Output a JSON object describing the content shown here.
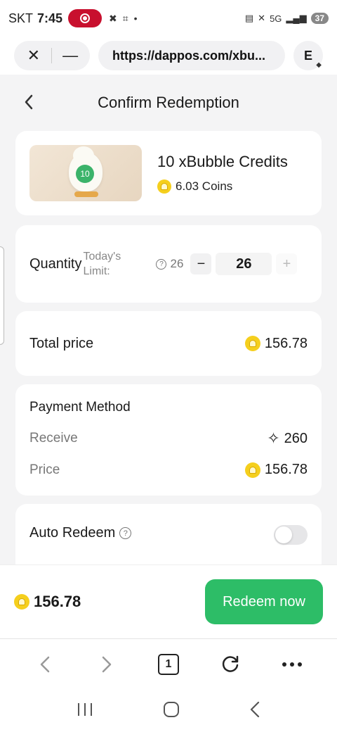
{
  "status_bar": {
    "carrier": "SKT",
    "time": "7:45",
    "network": "5G",
    "battery": "37"
  },
  "browser": {
    "url": "https://dappos.com/xbu...",
    "profile_initial": "E"
  },
  "page": {
    "title": "Confirm Redemption",
    "product": {
      "name": "10 xBubble Credits",
      "badge": "10",
      "price": "6.03 Coins"
    },
    "quantity": {
      "label": "Quantity",
      "limit_label": "Today's Limit:",
      "limit_value": "26",
      "value": "26",
      "minus": "−",
      "plus": "+"
    },
    "total": {
      "label": "Total price",
      "value": "156.78"
    },
    "payment": {
      "title": "Payment Method",
      "receive_label": "Receive",
      "receive_value": "260",
      "price_label": "Price",
      "price_value": "156.78"
    },
    "auto_redeem": {
      "label": "Auto Redeem",
      "enabled": false
    }
  },
  "footer": {
    "amount": "156.78",
    "redeem_label": "Redeem now"
  },
  "browser_nav": {
    "tab_count": "1"
  },
  "colors": {
    "accent_green": "#2dbd67",
    "coin_yellow": "#f5cf1d",
    "recording_red": "#c8102e",
    "page_bg": "#f4f4f5"
  },
  "icons": [
    "close-icon",
    "minimize-icon",
    "back-chevron-icon",
    "question-icon",
    "coin-icon",
    "sparkle-icon",
    "back-arrow-icon",
    "forward-arrow-icon",
    "reload-icon",
    "more-icon",
    "recents-icon",
    "home-icon",
    "system-back-icon"
  ]
}
